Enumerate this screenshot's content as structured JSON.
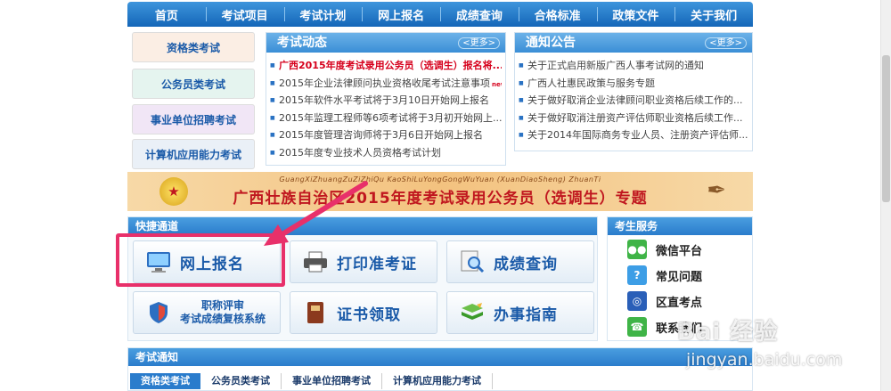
{
  "nav": [
    "首页",
    "考试项目",
    "考试计划",
    "网上报名",
    "成绩查询",
    "合格标准",
    "政策文件",
    "关于我们"
  ],
  "categories": [
    "资格类考试",
    "公务员类考试",
    "事业单位招聘考试",
    "计算机应用能力考试"
  ],
  "news": {
    "title": "考试动态",
    "more": "<更多>",
    "items": [
      "广西2015年度考试录用公务员（选调生）报名将...",
      "2015年企业法律顾问执业资格收尾考试注意事项",
      "2015年软件水平考试将于3月10日开始网上报名",
      "2015年监理工程师等6项考试将于3月初开始网上...",
      "2015年度管理咨询师将于3月6日开始网上报名",
      "2015年度专业技术人员资格考试计划"
    ],
    "hot_index": 0,
    "hot_tag": "new",
    "new_tag_index": 1,
    "new_tag": "new"
  },
  "notice": {
    "title": "通知公告",
    "more": "<更多>",
    "items": [
      "关于正式启用新版广西人事考试网的通知",
      "广西人社惠民政策与服务专题",
      "关于做好取消企业法律顾问职业资格后续工作的...",
      "关于做好取消注册资产评估师职业资格后续工作...",
      "关于2014年国际商务专业人员、注册资产评估师..."
    ]
  },
  "banner": {
    "subtitle": "GuangXiZhuangZuZiZhiQu KaoShiLuYongGongWuYuan (XuanDiaoSheng) ZhuanTi",
    "title": "广西壮族自治区2015年度考试录用公务员（选调生）专题"
  },
  "quick": {
    "title": "快捷通道",
    "buttons": [
      "网上报名",
      "打印准考证",
      "成绩查询",
      "职称评审",
      "考试成绩复核系统",
      "证书领取",
      "办事指南"
    ]
  },
  "services": {
    "title": "考生服务",
    "items": [
      "微信平台",
      "常见问题",
      "区直考点",
      "联系我们"
    ]
  },
  "exam_notice": {
    "title": "考试通知",
    "tabs": [
      "资格类考试",
      "公务员类考试",
      "事业单位招聘考试",
      "计算机应用能力考试"
    ]
  },
  "watermark": {
    "logo": "Bai 经验",
    "url": "jingyan.baidu.com"
  },
  "colors": {
    "nav_bg": "#1a72c6",
    "accent": "#2a7ccc",
    "highlight": "#e8306a",
    "hot_text": "#d6001c"
  }
}
